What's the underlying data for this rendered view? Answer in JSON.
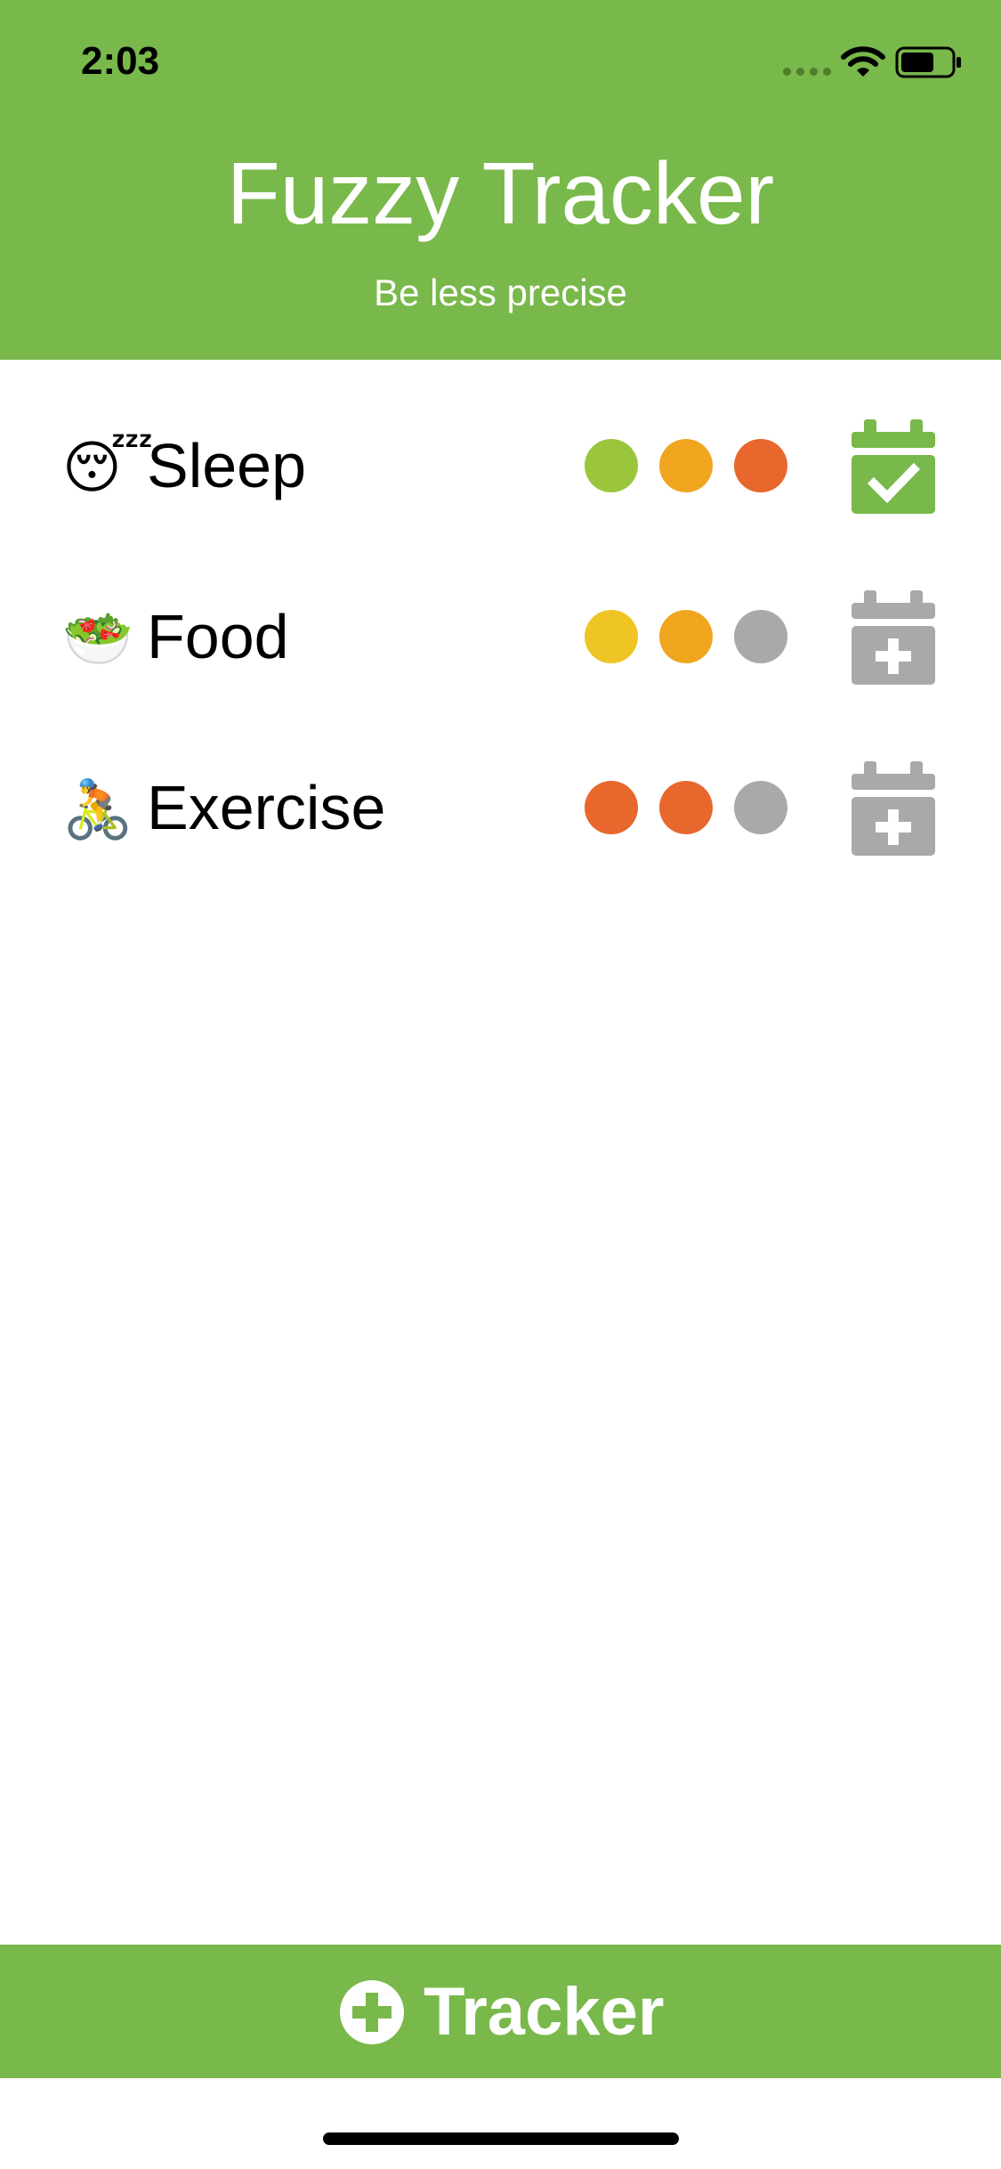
{
  "status_bar": {
    "time": "2:03"
  },
  "header": {
    "title": "Fuzzy Tracker",
    "subtitle": "Be less precise"
  },
  "colors": {
    "brand_green": "#79b84a",
    "dot_green": "#9bc63c",
    "dot_yellow": "#eec524",
    "dot_orange": "#f0a51f",
    "dot_red": "#e8672d",
    "dot_gray": "#a9a9a9",
    "calendar_done": "#79b84a",
    "calendar_pending": "#a9a9a9"
  },
  "trackers": [
    {
      "emoji": "😴",
      "label": "Sleep",
      "dots": [
        "dot_green",
        "dot_orange",
        "dot_red"
      ],
      "action_icon": "calendar-check-icon"
    },
    {
      "emoji": "🥗",
      "label": "Food",
      "dots": [
        "dot_yellow",
        "dot_orange",
        "dot_gray"
      ],
      "action_icon": "calendar-plus-icon"
    },
    {
      "emoji": "🚴",
      "label": "Exercise",
      "dots": [
        "dot_red",
        "dot_red",
        "dot_gray"
      ],
      "action_icon": "calendar-plus-icon"
    }
  ],
  "bottom_bar": {
    "label": "Tracker",
    "icon": "plus-circle-icon"
  }
}
